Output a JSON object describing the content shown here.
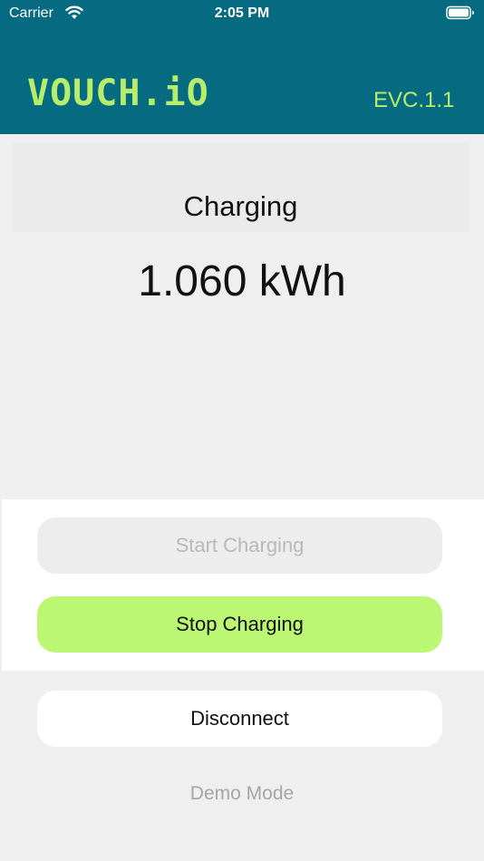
{
  "status_bar": {
    "carrier": "Carrier",
    "time": "2:05 PM",
    "wifi_icon": "wifi-icon",
    "battery_icon": "battery-icon"
  },
  "header": {
    "logo": "VOUCH.iO",
    "version": "EVC.1.1",
    "background_color": "#066a80",
    "accent_color": "#b6ee6c"
  },
  "session": {
    "status": "Charging",
    "energy": "1.060 kWh"
  },
  "controls": {
    "start_label": "Start Charging",
    "start_enabled": false,
    "stop_label": "Stop Charging",
    "stop_color": "#bcf774",
    "disconnect_label": "Disconnect",
    "demo_mode_label": "Demo Mode"
  }
}
